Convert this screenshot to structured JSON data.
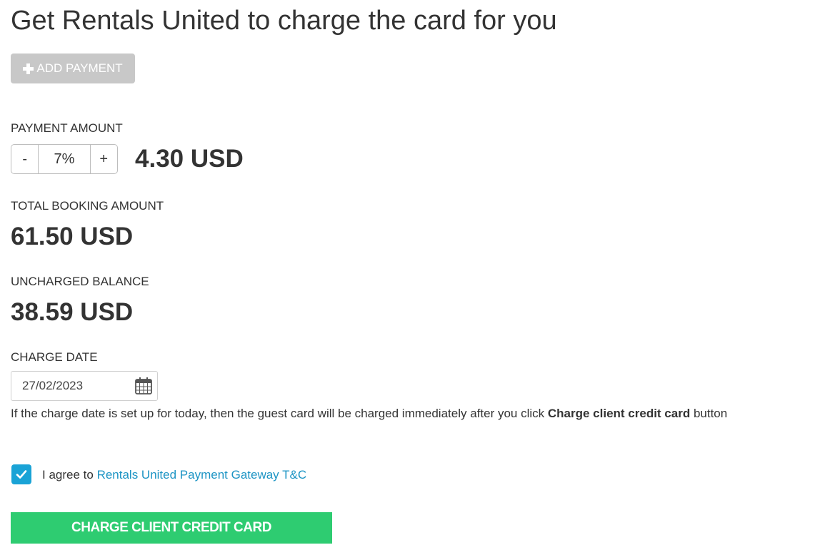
{
  "title": "Get Rentals United to charge the card for you",
  "add_payment": {
    "label": "ADD PAYMENT",
    "icon": "plus-icon"
  },
  "payment_amount": {
    "label": "PAYMENT AMOUNT",
    "decrement": "-",
    "percent": "7%",
    "increment": "+",
    "value": "4.30 USD"
  },
  "total_booking": {
    "label": "TOTAL BOOKING AMOUNT",
    "value": "61.50 USD"
  },
  "uncharged_balance": {
    "label": "UNCHARGED BALANCE",
    "value": "38.59 USD"
  },
  "charge_date": {
    "label": "CHARGE DATE",
    "value": "27/02/2023",
    "icon": "calendar-icon",
    "hint_prefix": "If the charge date is set up for today, then the guest card will be charged immediately after you click ",
    "hint_bold": "Charge client credit card",
    "hint_suffix": " button"
  },
  "agreement": {
    "checked": true,
    "prefix": "I agree to ",
    "link": "Rentals United Payment Gateway T&C"
  },
  "charge_button": {
    "label": "CHARGE CLIENT CREDIT CARD"
  },
  "colors": {
    "accent_blue": "#1aa3d6",
    "link_blue": "#1c94c4",
    "charge_green": "#2ecc71",
    "disabled_grey": "#c8c8c8",
    "text": "#333333"
  }
}
